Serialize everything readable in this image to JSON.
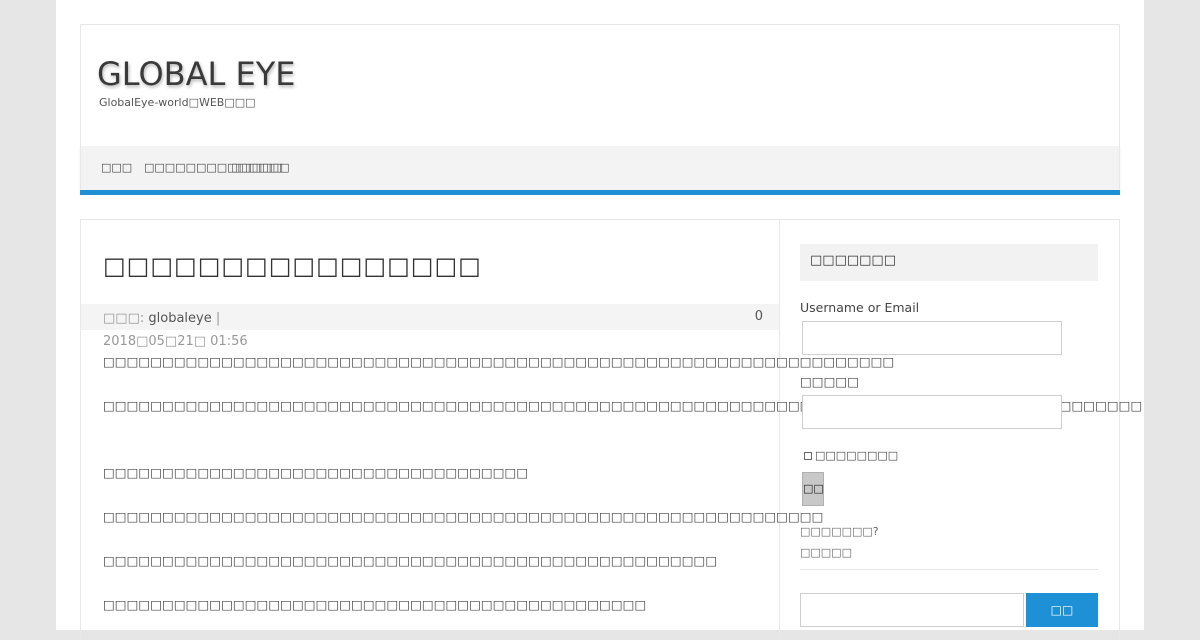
{
  "header": {
    "site_title": "GLOBAL EYE",
    "site_description": "GlobalEye-world□WEB□□□"
  },
  "nav": {
    "items": [
      "□□□",
      "□□□□□□□□□□□□□□",
      "□□□□□"
    ]
  },
  "post": {
    "title": "□□□□□□□□□□□□□□□□",
    "meta_prefix": "□□□: ",
    "author": "globaleye",
    "date": " | 2018□05□21□ 01:56",
    "comment_count": "0",
    "paragraphs": [
      "□□□□□□□□□□□□□□□□□□□□□□□□□□□□□□□□□□□□□□□□□□□□□□□□□□□□□□□□□□□□□□□□□□□",
      "□□□□□□□□□□□□□□□□□□□□□□□□□□□□□□□□□□□□□□□□□□□□□□□□□□□□□□□□□□□□□□□□□□□□□□□□□□□□□□□□□□□□□□□□",
      "□□□□□□□□□□□□□□□□□□□□□□□□□□□□□□□□□□□□",
      "□□□□□□□□□□□□□□□□□□□□□□□□□□□□□□□□□□□□□□□□□□□□□□□□□□□□□□□□□□□□□",
      "□□□□□□□□□□□□□□□□□□□□□□□□□□□□□□□□□□□□□□□□□□□□□□□□□□□□",
      "□□□□□□□□□□□□□□□□□□□□□□□□□□□□□□□□□□□□□□□□□□□□□□"
    ]
  },
  "sidebar": {
    "widget_title": "□□□□□□□",
    "username_label": "Username or Email",
    "password_label": "□□□□□",
    "remember_label": "□□□□□□□□",
    "login_button": "□□",
    "lost_password": "□□□□□□□?",
    "register": "□□□□□",
    "search_button": "□□"
  },
  "colors": {
    "accent": "#1e91d6",
    "background": "#e6e6e6"
  }
}
